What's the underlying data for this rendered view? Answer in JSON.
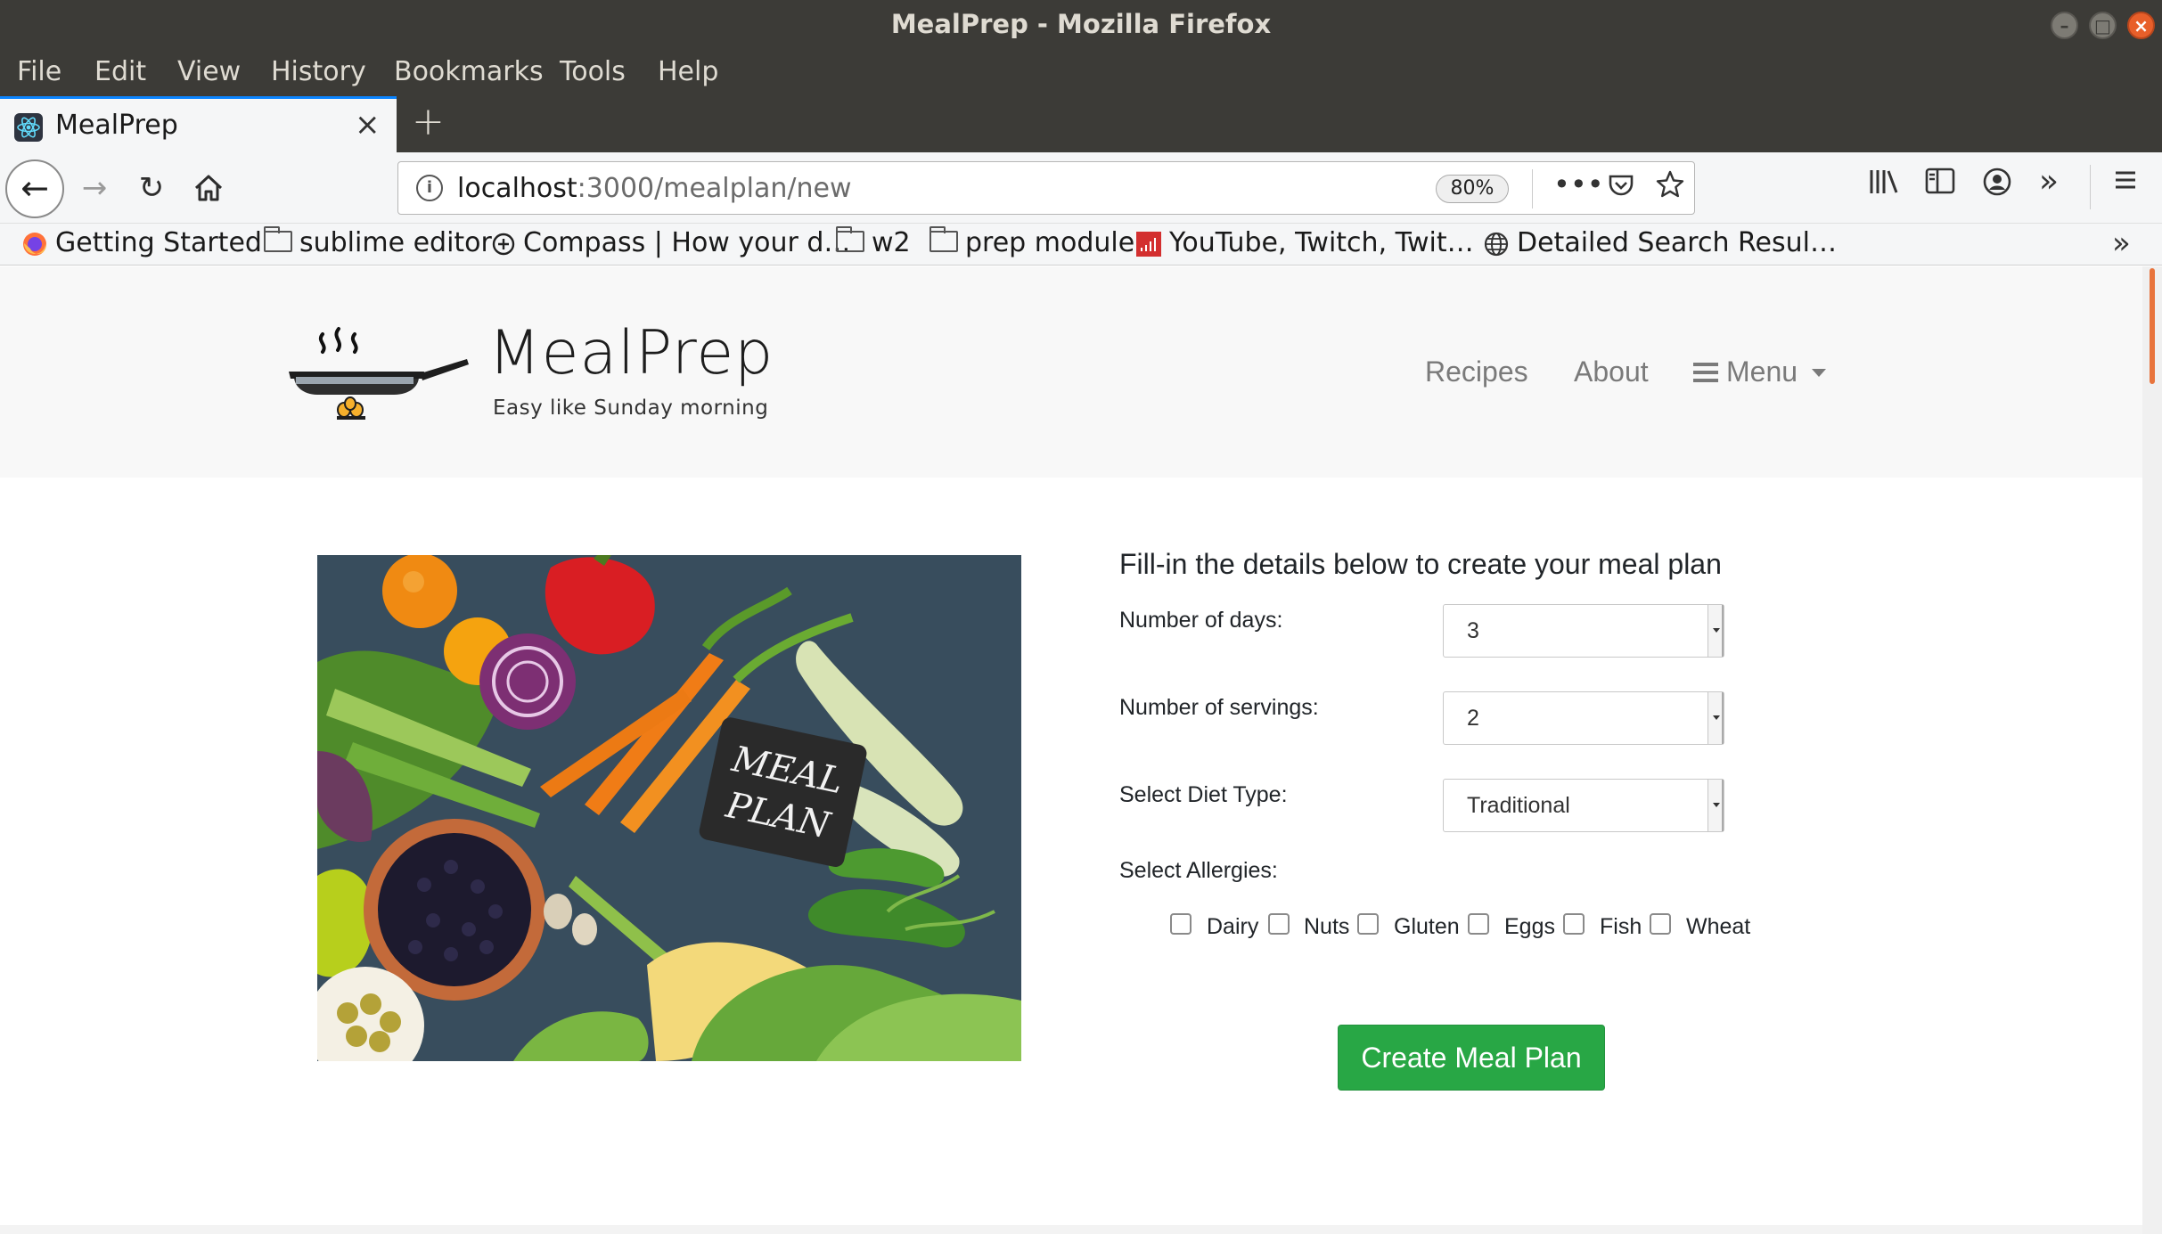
{
  "window": {
    "title": "MealPrep - Mozilla Firefox",
    "controls": {
      "minimize": "–",
      "maximize": "□",
      "close": "×"
    }
  },
  "menubar": [
    "File",
    "Edit",
    "View",
    "History",
    "Bookmarks",
    "Tools",
    "Help"
  ],
  "tab": {
    "title": "MealPrep",
    "close": "×",
    "new_tab": "+"
  },
  "navigation": {
    "url_host": "localhost",
    "url_path": ":3000/mealplan/new",
    "zoom": "80%",
    "page_actions": "•••"
  },
  "bookmarks": [
    {
      "label": "Getting Started",
      "icon": "firefox-icon"
    },
    {
      "label": "sublime editor",
      "icon": "folder-icon"
    },
    {
      "label": "Compass | How your d…",
      "icon": "compass-icon"
    },
    {
      "label": "w2",
      "icon": "folder-icon"
    },
    {
      "label": "prep module",
      "icon": "folder-icon"
    },
    {
      "label": "YouTube, Twitch, Twit…",
      "icon": "chart-icon"
    },
    {
      "label": "Detailed Search Resul…",
      "icon": "globe-icon"
    }
  ],
  "site": {
    "brand": "MealPrep",
    "tagline": "Easy like Sunday morning",
    "nav": {
      "recipes": "Recipes",
      "about": "About",
      "menu": "Menu"
    }
  },
  "hero_image": {
    "sign_line1": "MEAL",
    "sign_line2": "PLAN"
  },
  "form": {
    "heading": "Fill-in the details below to create your meal plan",
    "days_label": "Number of days:",
    "days_value": "3",
    "servings_label": "Number of servings:",
    "servings_value": "2",
    "diet_label": "Select Diet Type:",
    "diet_value": "Traditional",
    "allergies_label": "Select Allergies:",
    "allergies": [
      "Dairy",
      "Nuts",
      "Gluten",
      "Eggs",
      "Fish",
      "Wheat"
    ],
    "submit": "Create Meal Plan"
  },
  "colors": {
    "submit_bg": "#28a745",
    "titlebar_bg": "#3c3b37",
    "close_btn": "#e85f2a",
    "tab_accent": "#0a84ff"
  }
}
